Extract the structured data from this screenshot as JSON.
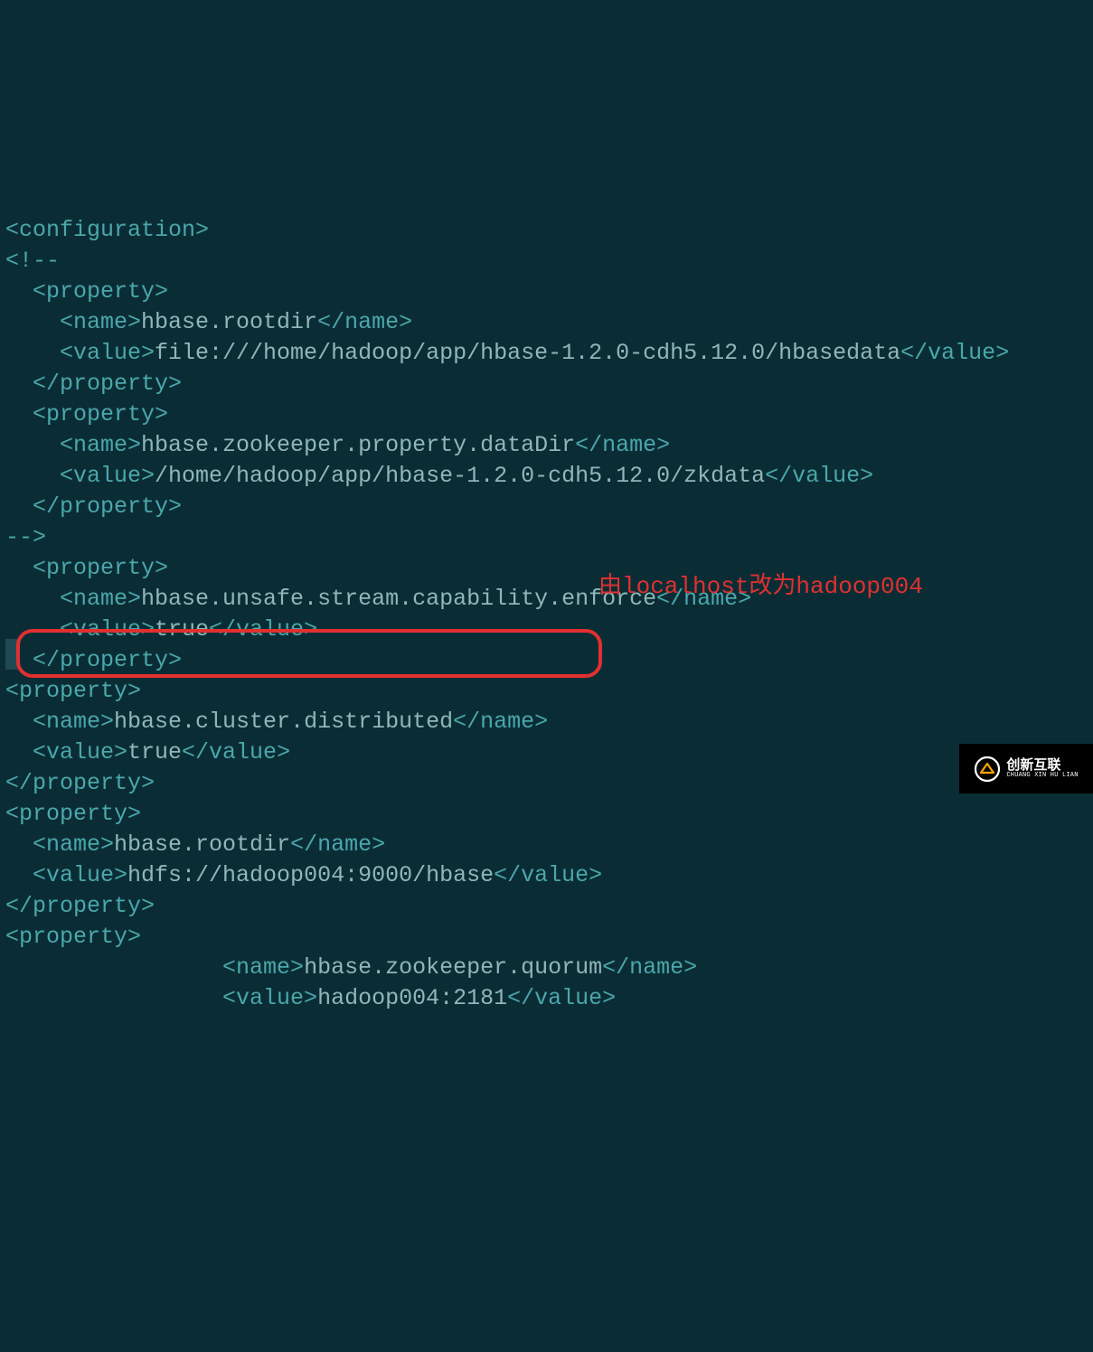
{
  "code": {
    "l1": {
      "a": "<configuration>"
    },
    "l2": {
      "a": "<!--"
    },
    "l3": {
      "a": "  <property>"
    },
    "l4": {
      "a": "    <name>",
      "b": "hbase.rootdir",
      "c": "</name>"
    },
    "l5": {
      "a": "    <value>",
      "b": "file:///home/hadoop/app/hbase-1.2.0-cdh5.12.0/hbasedata",
      "c": "</value>"
    },
    "l6": {
      "a": "  </property>"
    },
    "l7": {
      "a": "  <property>"
    },
    "l8": {
      "a": "    <name>",
      "b": "hbase.zookeeper.property.dataDir",
      "c": "</name>"
    },
    "l9": {
      "a": "    <value>",
      "b": "/home/hadoop/app/hbase-1.2.0-cdh5.12.0/zkdata",
      "c": "</value>"
    },
    "l10": {
      "a": "  </property>"
    },
    "l11": {
      "a": "-->"
    },
    "l12": {
      "a": "  <property>"
    },
    "l13": {
      "a": "    <name>",
      "b": "hbase.unsafe.stream.capability.enforce",
      "c": "</name>"
    },
    "l14": {
      "a": "    <value>",
      "b": "true",
      "c": "</value>"
    },
    "l15": {
      "a": "  </property>"
    },
    "l16": {
      "a": "<property>"
    },
    "l17": {
      "a": "  <name>",
      "b": "hbase.cluster.distributed",
      "c": "</name>"
    },
    "l18": {
      "a": "  <value>",
      "b": "true",
      "c": "</value>"
    },
    "l19": {
      "a": "</property>"
    },
    "l20": {
      "a": "<property>"
    },
    "l21": {
      "a": "  <name>",
      "b": "hbase.rootdir",
      "c": "</name>"
    },
    "l22": {
      "a": "  <value>",
      "b": "hdfs://hadoop004:9000/hbase",
      "c": "</value>"
    },
    "l23": {
      "a": "</property>"
    },
    "l24": {
      "a": "<property>"
    },
    "l25": {
      "a": "                <name>",
      "b": "hbase.zookeeper.quorum",
      "c": "</name>"
    },
    "l26": {
      "a": "                <value>",
      "b": "hadoop004:2181",
      "c": "</value>"
    }
  },
  "annotation": "由localhost改为hadoop004",
  "watermark": {
    "cn": "创新互联",
    "en": "CHUANG XIN HU LIAN"
  }
}
